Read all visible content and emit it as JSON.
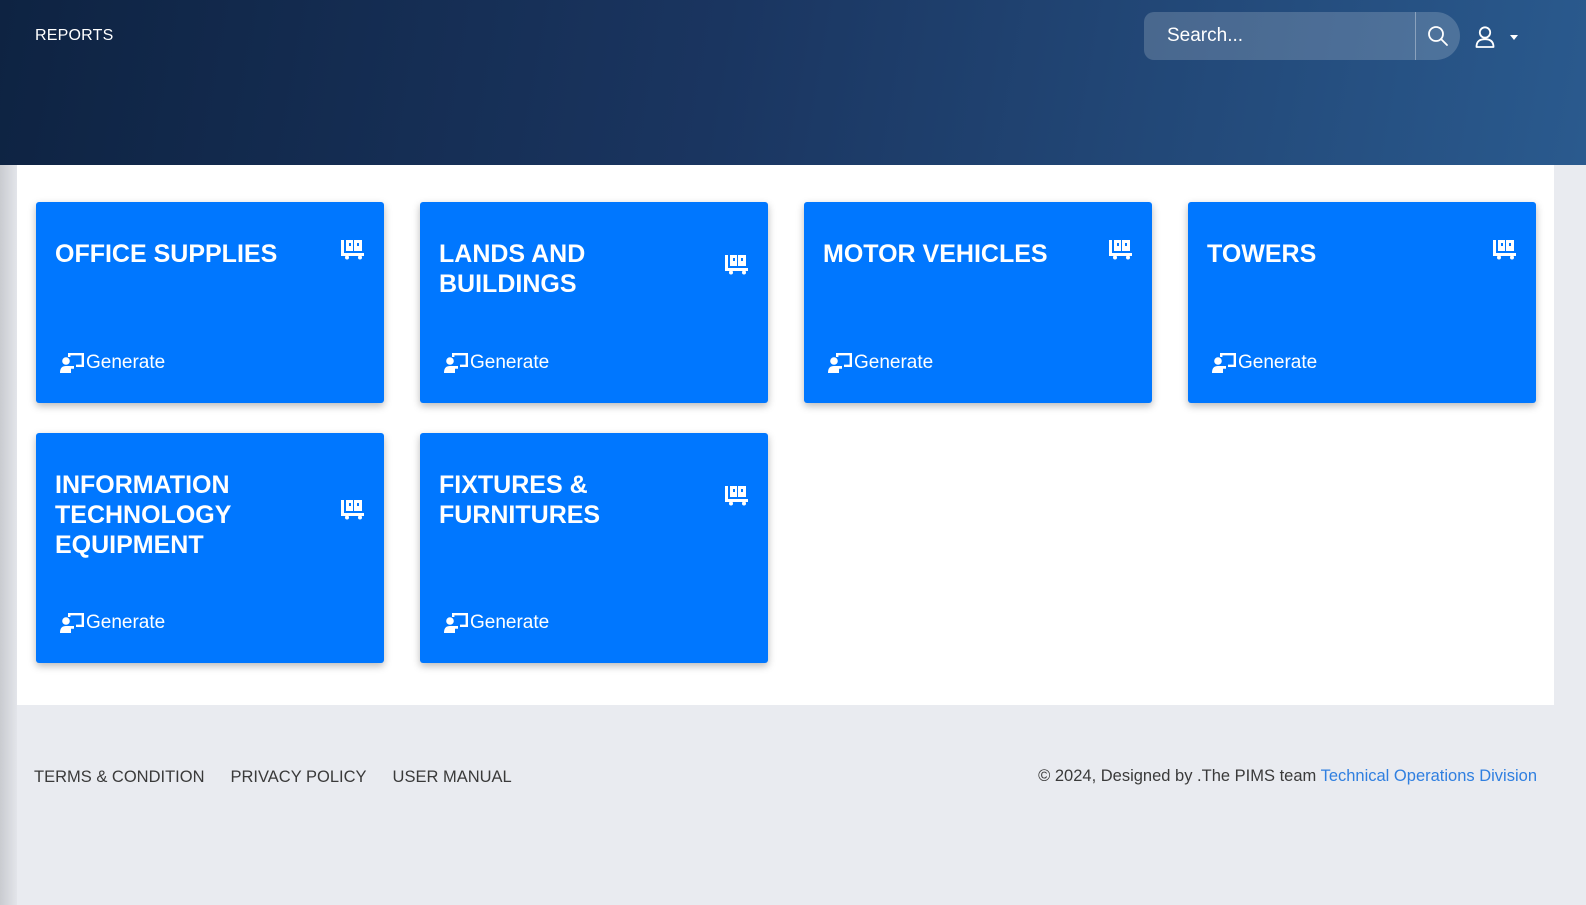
{
  "header": {
    "title": "REPORTS",
    "search_placeholder": "Search..."
  },
  "cards": [
    {
      "title": "OFFICE SUPPLIES",
      "button_label": "Generate",
      "icon": "dolly-flatbed-icon"
    },
    {
      "title": "LANDS AND BUILDINGS",
      "button_label": "Generate",
      "icon": "dolly-flatbed-icon"
    },
    {
      "title": "MOTOR VEHICLES",
      "button_label": "Generate",
      "icon": "dolly-flatbed-icon"
    },
    {
      "title": "TOWERS",
      "button_label": "Generate",
      "icon": "dolly-flatbed-icon"
    },
    {
      "title": "INFORMATION TECHNOLOGY EQUIPMENT",
      "button_label": "Generate",
      "icon": "dolly-flatbed-icon"
    },
    {
      "title": "FIXTURES & FURNITURES",
      "button_label": "Generate",
      "icon": "dolly-flatbed-icon"
    }
  ],
  "footer": {
    "links": [
      "TERMS & CONDITION",
      "PRIVACY POLICY",
      "USER MANUAL"
    ],
    "copyright": "© 2024, Designed by .The PIMS team",
    "credit_link": "Technical Operations Division"
  },
  "colors": {
    "card_blue": "#0077ff",
    "header_dark": "#0e2342",
    "link_blue": "#2f7fe0"
  }
}
